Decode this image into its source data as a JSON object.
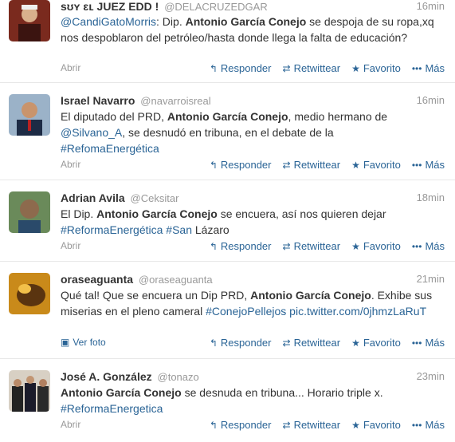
{
  "footer_labels": {
    "open": "Abrir",
    "reply": "Responder",
    "retweet": "Retwittear",
    "favorite": "Favorito",
    "more": "Más",
    "photo": "Ver foto"
  },
  "colors": {
    "link": "#2a6496",
    "muted": "#999999",
    "divider": "#e8e8e8"
  },
  "tweets": [
    {
      "fullname": "sʊʏ ɛʟ JUEZ EDD !",
      "screenname": "@DELACRUZEDGAR",
      "time": "16min",
      "parts": [
        {
          "t": "mention",
          "v": "@CandiGatoMorris"
        },
        {
          "t": "text",
          "v": ": Dip. "
        },
        {
          "t": "bold",
          "v": "Antonio García Conejo"
        },
        {
          "t": "text",
          "v": " se despoja de su ropa,xq nos despoblaron del petróleo/hasta donde llega la falta de educación?"
        }
      ]
    },
    {
      "fullname": "Israel Navarro",
      "screenname": "@navarroisreal",
      "time": "16min",
      "parts": [
        {
          "t": "text",
          "v": "El diputado del PRD, "
        },
        {
          "t": "bold",
          "v": "Antonio García Conejo"
        },
        {
          "t": "text",
          "v": ", medio hermano de "
        },
        {
          "t": "mention",
          "v": "@Silvano_A"
        },
        {
          "t": "text",
          "v": ", se desnudó en tribuna, en el debate de la "
        },
        {
          "t": "hashtag",
          "v": "#RefomaEnergética"
        }
      ]
    },
    {
      "fullname": "Adrian Avila",
      "screenname": "@Ceksitar",
      "time": "18min",
      "parts": [
        {
          "t": "text",
          "v": "El Dip. "
        },
        {
          "t": "bold",
          "v": "Antonio García Conejo"
        },
        {
          "t": "text",
          "v": " se encuera, así nos quieren dejar "
        },
        {
          "t": "hashtag",
          "v": "#ReformaEnergética"
        },
        {
          "t": "text",
          "v": " "
        },
        {
          "t": "hashtag",
          "v": "#San"
        },
        {
          "t": "text",
          "v": " Lázaro"
        }
      ]
    },
    {
      "fullname": "oraseaguanta",
      "screenname": "@oraseaguanta",
      "time": "21min",
      "has_photo": true,
      "parts": [
        {
          "t": "text",
          "v": "Qué tal! Que se encuera un Dip PRD, "
        },
        {
          "t": "bold",
          "v": "Antonio García Conejo"
        },
        {
          "t": "text",
          "v": ". Exhibe sus miserias en el pleno cameral "
        },
        {
          "t": "hashtag",
          "v": "#ConejoPellejos"
        },
        {
          "t": "text",
          "v": " "
        },
        {
          "t": "link",
          "v": "pic.twitter.com/0jhmzLaRuT"
        }
      ]
    },
    {
      "fullname": "José A. González",
      "screenname": "@tonazo",
      "time": "23min",
      "parts": [
        {
          "t": "bold",
          "v": "Antonio García Conejo"
        },
        {
          "t": "text",
          "v": " se desnuda en tribuna... Horario triple x. "
        },
        {
          "t": "hashtag",
          "v": "#ReformaEnergetica"
        }
      ]
    }
  ]
}
